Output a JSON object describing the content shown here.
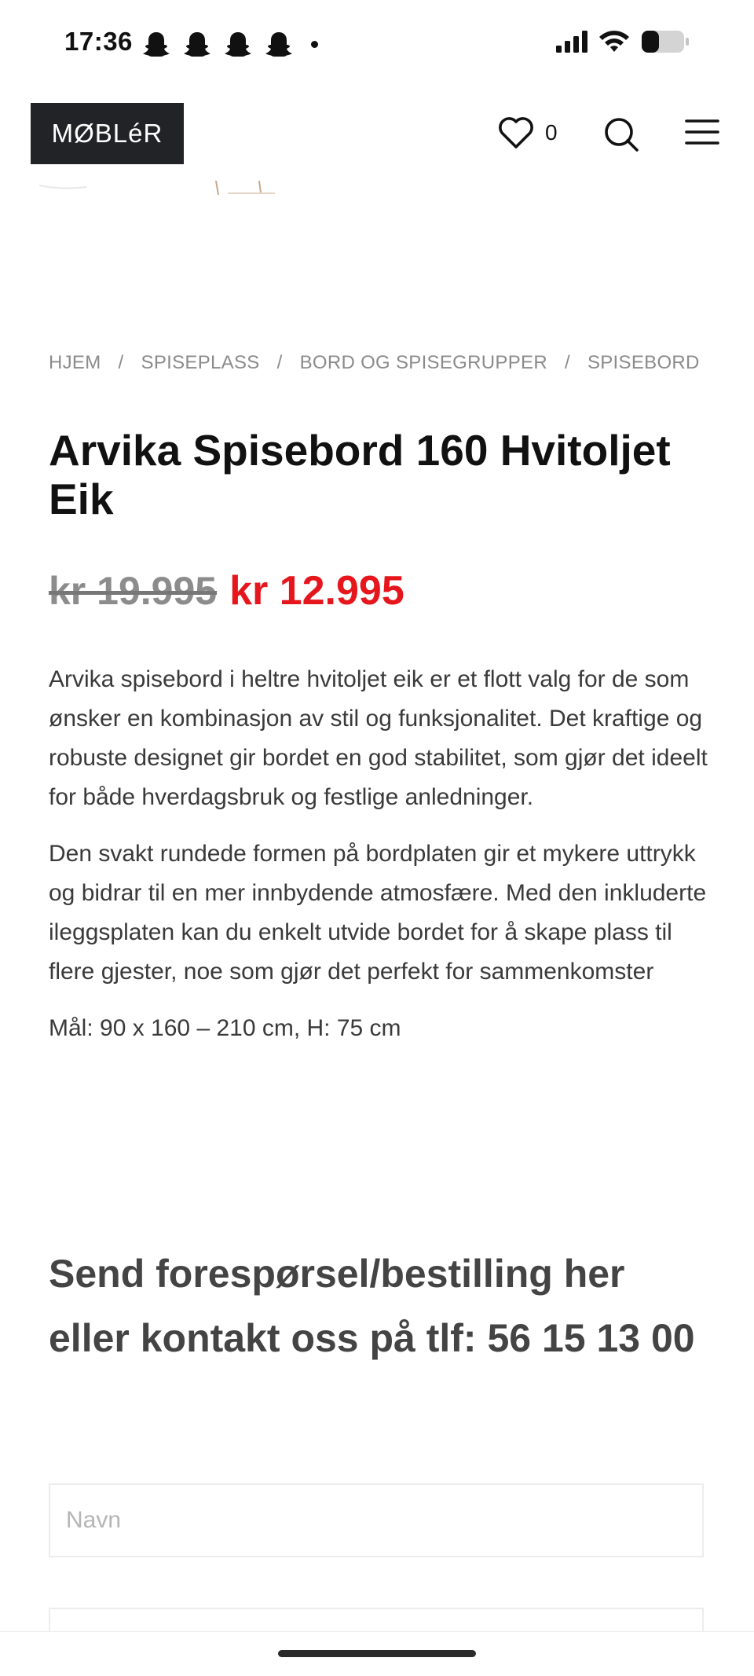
{
  "status_bar": {
    "time": "17:36",
    "notification_icons": [
      "snapchat-icon",
      "snapchat-icon",
      "snapchat-icon",
      "snapchat-icon"
    ],
    "system_icons": [
      "signal-icon",
      "wifi-icon",
      "battery-icon"
    ]
  },
  "header": {
    "logo_text": "MØBLéR",
    "wishlist_count": "0",
    "icons": [
      "heart-icon",
      "search-icon",
      "menu-icon"
    ]
  },
  "breadcrumb": {
    "items": [
      "HJEM",
      "SPISEPLASS",
      "BORD OG SPISEGRUPPER",
      "SPISEBORD"
    ],
    "separator": "/"
  },
  "product": {
    "title": "Arvika Spisebord 160 Hvitoljet Eik",
    "old_price": "kr 19.995",
    "new_price": "kr 12.995",
    "description": [
      "Arvika spisebord i heltre hvitoljet eik er et flott valg for de som ønsker en kombinasjon av stil og funksjonalitet. Det kraftige og robuste designet gir bordet en god stabilitet, som gjør det ideelt for både hverdagsbruk og festlige anledninger.",
      "Den svakt rundede formen på bordplaten gir et mykere uttrykk og bidrar til en mer innbydende atmosfære. Med den inkluderte ileggsplaten kan du enkelt utvide bordet for å skape plass til flere gjester, noe som gjør det perfekt for sammenkomster",
      "Mål: 90 x 160 – 210 cm, H: 75 cm"
    ]
  },
  "form": {
    "heading": "Send forespørsel/bestilling her eller kontakt oss på tlf: 56 15 13 00",
    "name_placeholder": "Navn",
    "second_placeholder": ""
  },
  "colors": {
    "sale_price": "#e6161d",
    "old_price": "#8c8c8c",
    "logo_bg": "#222326",
    "breadcrumb": "#8b8b8b"
  }
}
